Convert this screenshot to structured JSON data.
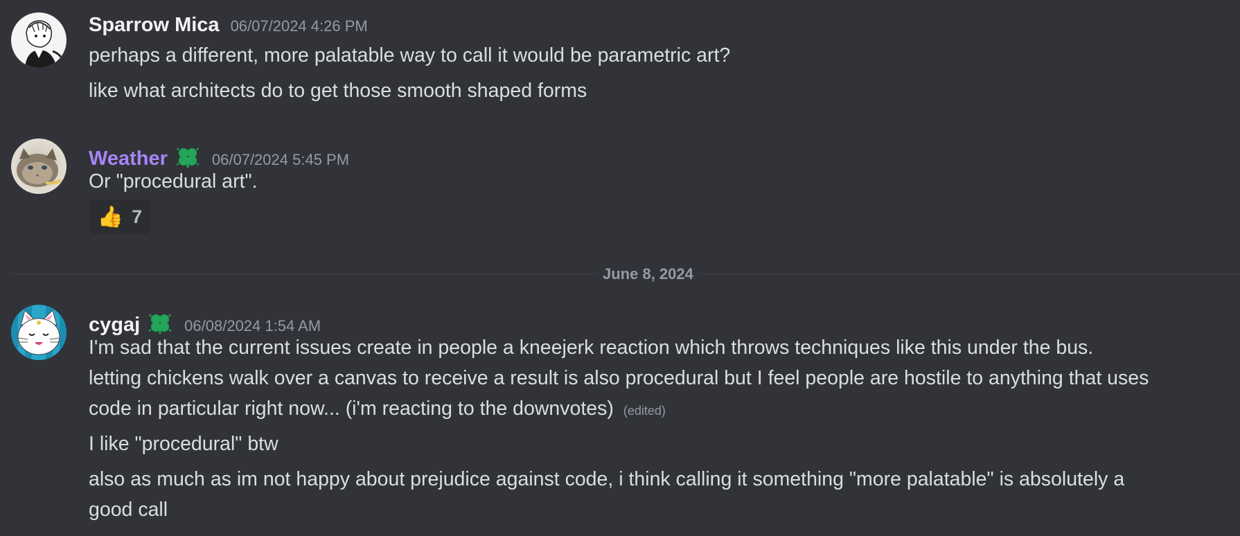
{
  "messages": [
    {
      "username": "Sparrow Mica",
      "timestamp": "06/07/2024 4:26 PM",
      "lines": [
        "perhaps a different, more palatable way to call it would be parametric art?",
        "like what architects do to get those smooth shaped forms"
      ]
    },
    {
      "username": "Weather",
      "username_color": "#a785f8",
      "timestamp": "06/07/2024 5:45 PM",
      "lines": [
        "Or \"procedural art\"."
      ],
      "reaction": {
        "emoji": "👍",
        "count": "7"
      }
    },
    {
      "username": "cygaj",
      "timestamp": "06/08/2024 1:54 AM",
      "lines": [
        "I'm sad that the current issues create in people a kneejerk reaction which throws techniques like this under the bus.",
        "letting chickens walk over a canvas to receive a result is also procedural but I feel people are hostile to anything that uses",
        "code in particular right now... (i'm reacting to the downvotes)",
        "I like \"procedural\" btw",
        "also as much as im not happy about prejudice against code, i think calling it something \"more palatable\" is absolutely a",
        "good call"
      ],
      "edited_label": "(edited)"
    }
  ],
  "date_divider": "June 8, 2024",
  "colors": {
    "background": "#313338",
    "text": "#dbdee1",
    "muted": "#949ba4",
    "badge_green": "#23a55a"
  }
}
